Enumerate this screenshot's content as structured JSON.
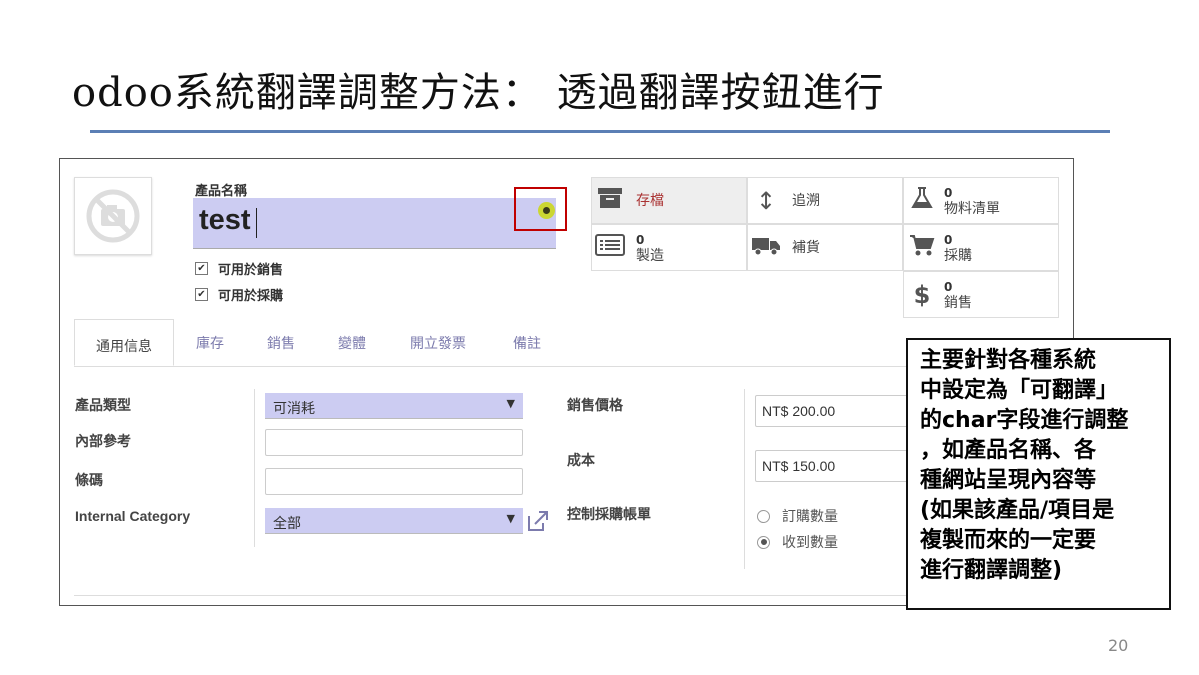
{
  "slide": {
    "title": "odoo系統翻譯調整方法：  透過翻譯按鈕進行",
    "page_number": "20",
    "callout": [
      "主要針對各種系統",
      "中設定為「可翻譯」",
      "的char字段進行調整",
      "，如產品名稱、各",
      "種網站呈現內容等",
      "(如果該產品/項目是",
      "複製而來的一定要",
      "進行翻譯調整)"
    ]
  },
  "product": {
    "name_label": "產品名稱",
    "name_value": "test",
    "translate_icon": "globe-icon",
    "checkboxes": [
      {
        "label": "可用於銷售",
        "checked": true
      },
      {
        "label": "可用於採購",
        "checked": true
      }
    ]
  },
  "smart_buttons": {
    "stock": {
      "label": "存檔",
      "icon": "archive-icon"
    },
    "traceability": {
      "label": "追溯",
      "icon": "arrows-vertical-icon"
    },
    "bom": {
      "count": "0",
      "label": "物料清單",
      "icon": "flask-icon"
    },
    "manufacturing": {
      "count": "0",
      "label": "製造",
      "icon": "list-icon"
    },
    "replenish": {
      "label": "補貨",
      "icon": "truck-icon"
    },
    "purchase": {
      "count": "0",
      "label": "採購",
      "icon": "cart-icon"
    },
    "sales": {
      "count": "0",
      "label": "銷售",
      "icon": "dollar-icon"
    }
  },
  "tabs": [
    "通用信息",
    "庫存",
    "銷售",
    "變體",
    "開立發票",
    "備註"
  ],
  "general": {
    "product_type_label": "產品類型",
    "product_type_value": "可消耗",
    "internal_ref_label": "內部參考",
    "internal_ref_value": "",
    "barcode_label": "條碼",
    "barcode_value": "",
    "category_label": "Internal Category",
    "category_value": "全部",
    "sale_price_label": "銷售價格",
    "sale_price_value": "NT$ 200.00",
    "cost_label": "成本",
    "cost_value": "NT$ 150.00",
    "purchase_control_label": "控制採購帳單",
    "purchase_control_options": [
      {
        "label": "訂購數量",
        "selected": false
      },
      {
        "label": "收到數量",
        "selected": true
      }
    ]
  },
  "colors": {
    "highlight_border": "#c00000",
    "input_bg": "#ccccf2",
    "tab_text": "#7c7bad",
    "title_rule": "#5b7fb5"
  }
}
